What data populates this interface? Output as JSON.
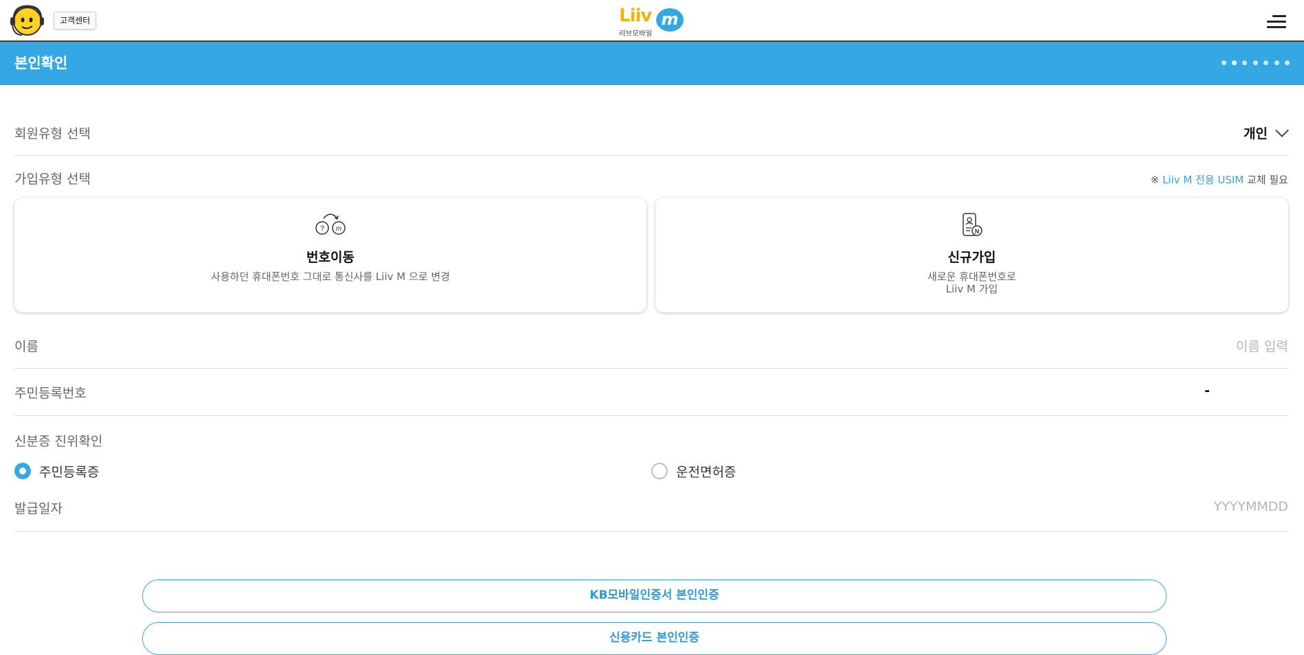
{
  "header": {
    "customer_center_label": "고객센터",
    "logo_text": "Liiv",
    "logo_bubble_text": "m",
    "logo_subtitle": "리브모바일",
    "menu_icon": "hamburger-menu-icon"
  },
  "titlebar": {
    "title": "본인확인",
    "step_total": 7,
    "step_current": 2
  },
  "member_type": {
    "label": "회원유형 선택",
    "value": "개인"
  },
  "join_type": {
    "label": "가입유형 선택",
    "note_prefix": "※ ",
    "note_highlight": "Liiv M 전용 USIM",
    "note_suffix": " 교체 필요",
    "options": [
      {
        "icon": "number-transfer-icon",
        "title": "번호이동",
        "desc_lines": [
          "사용하던 휴대폰번호 그대로 통신사를 Liiv M 으로 변경"
        ]
      },
      {
        "icon": "new-phone-icon",
        "title": "신규가입",
        "desc_lines": [
          "새로운 휴대폰번호로",
          "Liiv M 가입"
        ]
      }
    ]
  },
  "name_field": {
    "label": "이름",
    "placeholder": "이름 입력"
  },
  "resident_number": {
    "label": "주민등록번호",
    "separator": "-"
  },
  "id_verify": {
    "label": "신분증 진위확인",
    "options": [
      {
        "label": "주민등록증",
        "selected": true
      },
      {
        "label": "운전면허증",
        "selected": false
      }
    ]
  },
  "issue_date": {
    "label": "발급일자",
    "placeholder": "YYYYMMDD"
  },
  "buttons": {
    "kb_cert": "KB모바일인증서 본인인증",
    "credit_card": "신용카드 본인인증"
  },
  "colors": {
    "accent": "#34a8e3",
    "logo_yellow": "#f5b400"
  }
}
